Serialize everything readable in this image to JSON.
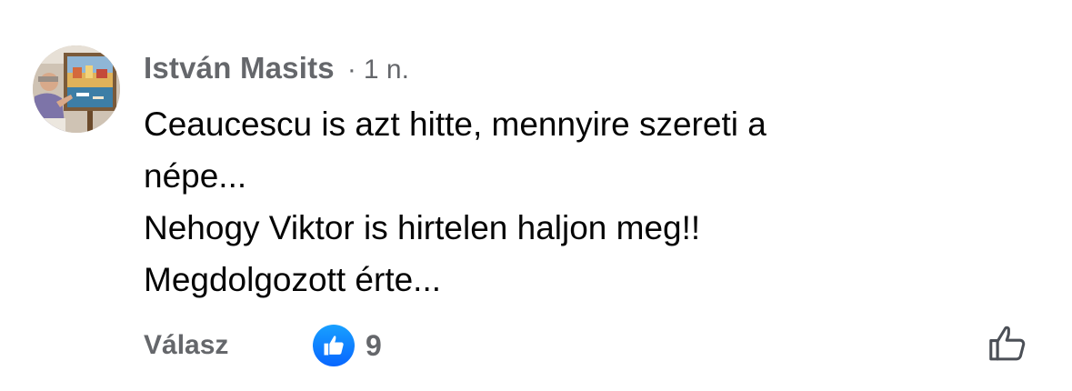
{
  "comment": {
    "author": "István Masits",
    "separator": "·",
    "time": "1 n.",
    "text_lines": [
      "Ceaucescu is azt hitte, mennyire szereti a",
      "népe...",
      "Nehogy Viktor is hirtelen haljon meg!!",
      "Megdolgozott érte..."
    ],
    "avatar_icon": "painting-photo-avatar"
  },
  "actions": {
    "reply_label": "Válasz",
    "reaction_icon": "like-thumb-icon",
    "reaction_color": "#0866ff",
    "reaction_count": "9",
    "like_button_icon": "thumbs-up-outline-icon"
  },
  "colors": {
    "secondary_text": "#65676b",
    "primary_text": "#050505"
  }
}
